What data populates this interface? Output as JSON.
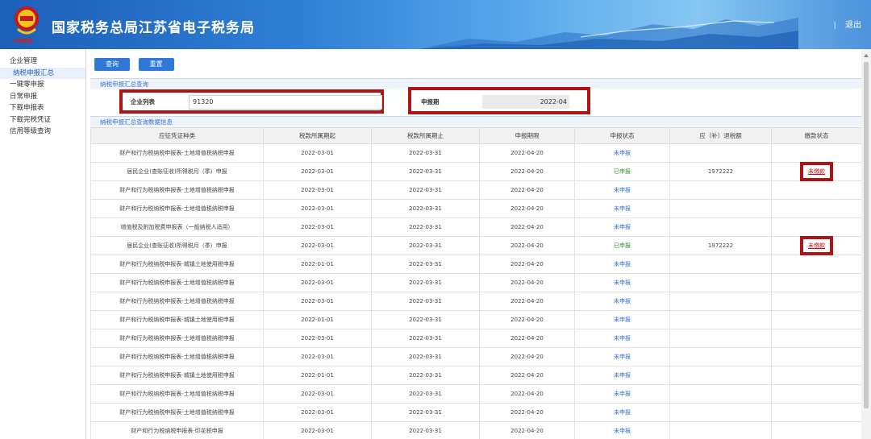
{
  "header": {
    "title": "国家税务总局江苏省电子税务局",
    "emblem_caption": "中国税务",
    "logout_sep": "|",
    "logout_label": "退出"
  },
  "sidebar": {
    "items": [
      {
        "label": "企业管理"
      },
      {
        "label": "纳税申报汇总",
        "active": true
      },
      {
        "label": "一键零申报"
      },
      {
        "label": "日常申报"
      },
      {
        "label": "下载申报表"
      },
      {
        "label": "下载完税凭证"
      },
      {
        "label": "信用等级查询"
      }
    ]
  },
  "toolbar": {
    "query_label": "查询",
    "reset_label": "重置"
  },
  "query_section": {
    "title": "纳税申报汇总查询",
    "company_label": "企业列表",
    "company_value": "91320",
    "period_label": "申报期",
    "period_value": "2022-04"
  },
  "result_section": {
    "title": "纳税申报汇总查询数据信息"
  },
  "table": {
    "headers": [
      "应征凭证种类",
      "税款所属期起",
      "税款所属期止",
      "申报期限",
      "申报状态",
      "应（补）退税额",
      "缴款状态"
    ],
    "rows": [
      [
        "财产和行为税纳税申报表-土地增值税纳税申报",
        "2022-03-01",
        "2022-03-31",
        "2022-04-20",
        "未申报",
        "",
        ""
      ],
      [
        "居民企业(查账征收)所得税月（季）申报",
        "2022-03-01",
        "2022-03-31",
        "2022-04-20",
        "已申报",
        "1972222",
        "未缴款"
      ],
      [
        "财产和行为税纳税申报表-土地增值税纳税申报",
        "2022-03-01",
        "2022-03-31",
        "2022-04-20",
        "未申报",
        "",
        ""
      ],
      [
        "财产和行为税纳税申报表-土地增值税纳税申报",
        "2022-03-01",
        "2022-03-31",
        "2022-04-20",
        "未申报",
        "",
        ""
      ],
      [
        "增值税及附加税费申报表（一般纳税人适用）",
        "2022-03-01",
        "2022-03-31",
        "2022-04-20",
        "未申报",
        "",
        ""
      ],
      [
        "居民企业(查账征收)所得税月（季）申报",
        "2022-03-01",
        "2022-03-31",
        "2022-04-20",
        "已申报",
        "1972222",
        "未缴款"
      ],
      [
        "财产和行为税纳税申报表-城镇土地使用税申报",
        "2022-01-01",
        "2022-03-31",
        "2022-04-20",
        "未申报",
        "",
        ""
      ],
      [
        "财产和行为税纳税申报表-土地增值税纳税申报",
        "2022-03-01",
        "2022-03-31",
        "2022-04-20",
        "未申报",
        "",
        ""
      ],
      [
        "财产和行为税纳税申报表-土地增值税纳税申报",
        "2022-03-01",
        "2022-03-31",
        "2022-04-20",
        "未申报",
        "",
        ""
      ],
      [
        "财产和行为税纳税申报表-城镇土地使用税申报",
        "2022-01-01",
        "2022-03-31",
        "2022-04-20",
        "未申报",
        "",
        ""
      ],
      [
        "财产和行为税纳税申报表-土地增值税纳税申报",
        "2022-03-01",
        "2022-03-31",
        "2022-04-20",
        "未申报",
        "",
        ""
      ],
      [
        "财产和行为税纳税申报表-土地增值税纳税申报",
        "2022-03-01",
        "2022-03-31",
        "2022-04-20",
        "未申报",
        "",
        ""
      ],
      [
        "财产和行为税纳税申报表-城镇土地使用税申报",
        "2022-01-01",
        "2022-03-31",
        "2022-04-20",
        "未申报",
        "",
        ""
      ],
      [
        "财产和行为税纳税申报表-土地增值税纳税申报",
        "2022-03-01",
        "2022-03-31",
        "2022-04-20",
        "未申报",
        "",
        ""
      ],
      [
        "财产和行为税纳税申报表-土地增值税纳税申报",
        "2022-03-01",
        "2022-03-31",
        "2022-04-20",
        "未申报",
        "",
        ""
      ],
      [
        "财产和行为税纳税申报表-印花税申报",
        "2022-03-01",
        "2022-03-31",
        "2022-04-20",
        "未申报",
        "",
        ""
      ]
    ]
  },
  "colors": {
    "accent": "#2f78d6",
    "highlight_box": "#b01313",
    "status_not": "#2d6fd1",
    "status_done": "#2a8f2a",
    "unpaid": "#c01414"
  },
  "icons": {
    "emblem": "tax-emblem-icon",
    "scroll_up": "scroll-up-arrow-icon"
  }
}
